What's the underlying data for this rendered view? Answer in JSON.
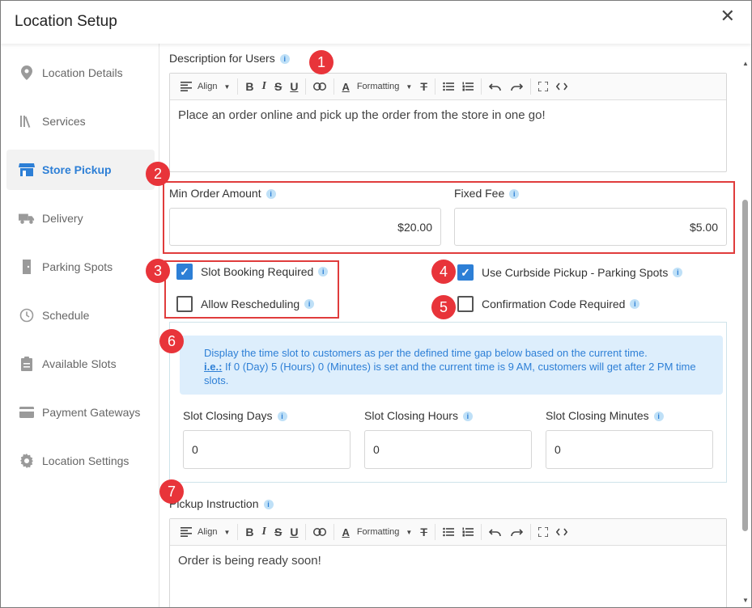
{
  "dialog": {
    "title": "Location Setup",
    "close_glyph": "✕"
  },
  "sidebar": {
    "items": [
      {
        "label": "Location Details",
        "icon": "map-pin-icon"
      },
      {
        "label": "Services",
        "icon": "books-icon"
      },
      {
        "label": "Store Pickup",
        "icon": "store-icon",
        "active": true
      },
      {
        "label": "Delivery",
        "icon": "delivery-truck-icon"
      },
      {
        "label": "Parking Spots",
        "icon": "door-icon"
      },
      {
        "label": "Schedule",
        "icon": "clock-icon"
      },
      {
        "label": "Available Slots",
        "icon": "clipboard-icon"
      },
      {
        "label": "Payment Gateways",
        "icon": "credit-card-icon"
      },
      {
        "label": "Location Settings",
        "icon": "gear-icon"
      }
    ]
  },
  "toolbar": {
    "align_label": "Align",
    "formatting_label": "Formatting"
  },
  "description": {
    "label": "Description for Users",
    "text": "Place an order online and pick up the order from the store in one go!"
  },
  "min_order": {
    "label": "Min Order Amount",
    "value": "$20.00"
  },
  "fixed_fee": {
    "label": "Fixed Fee",
    "value": "$5.00"
  },
  "checkboxes": {
    "slot_booking": {
      "label": "Slot Booking Required",
      "checked": true
    },
    "allow_rescheduling": {
      "label": "Allow Rescheduling",
      "checked": false
    },
    "curbside": {
      "label": "Use Curbside Pickup - Parking Spots",
      "checked": true
    },
    "confirmation_code": {
      "label": "Confirmation Code Required",
      "checked": false
    }
  },
  "slot_notice": {
    "line1": "Display the time slot to customers as per the defined time gap below based on the current time.",
    "ie_label": "i.e.:",
    "line2": " If 0 (Day) 5 (Hours) 0 (Minutes) is set and the current time is 9 AM, customers will get after 2 PM time slots."
  },
  "slot_closing": {
    "days": {
      "label": "Slot Closing Days",
      "value": "0"
    },
    "hours": {
      "label": "Slot Closing Hours",
      "value": "0"
    },
    "minutes": {
      "label": "Slot Closing Minutes",
      "value": "0"
    }
  },
  "pickup_instruction": {
    "label": "Pickup Instruction",
    "text": "Order is being ready soon!"
  },
  "badges": [
    "1",
    "2",
    "3",
    "4",
    "5",
    "6",
    "7"
  ],
  "colors": {
    "accent": "#2d7fd6",
    "annotation_red": "#e03c3c",
    "notice_bg": "#ddeefc"
  }
}
